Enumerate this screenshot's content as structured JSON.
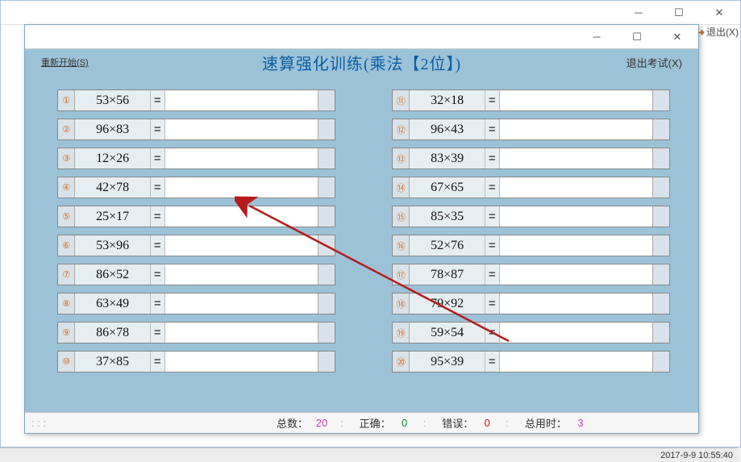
{
  "outer_window": {
    "exit_label": "退出(X)"
  },
  "inner_window": {
    "restart_label": "重新开始(S)",
    "title": "速算强化训练(乘法【2位】)",
    "exit_exam_label": "退出考试(X)"
  },
  "problems_left": [
    {
      "n": "①",
      "expr": "53×56"
    },
    {
      "n": "②",
      "expr": "96×83"
    },
    {
      "n": "③",
      "expr": "12×26"
    },
    {
      "n": "④",
      "expr": "42×78"
    },
    {
      "n": "⑤",
      "expr": "25×17"
    },
    {
      "n": "⑥",
      "expr": "53×96"
    },
    {
      "n": "⑦",
      "expr": "86×52"
    },
    {
      "n": "⑧",
      "expr": "63×49"
    },
    {
      "n": "⑨",
      "expr": "86×78"
    },
    {
      "n": "⑩",
      "expr": "37×85"
    }
  ],
  "problems_right": [
    {
      "n": "⑪",
      "expr": "32×18"
    },
    {
      "n": "⑫",
      "expr": "96×43"
    },
    {
      "n": "⑬",
      "expr": "83×39"
    },
    {
      "n": "⑭",
      "expr": "67×65"
    },
    {
      "n": "⑮",
      "expr": "85×35"
    },
    {
      "n": "⑯",
      "expr": "52×76"
    },
    {
      "n": "⑰",
      "expr": "78×87"
    },
    {
      "n": "⑱",
      "expr": "79×92"
    },
    {
      "n": "⑲",
      "expr": "59×54"
    },
    {
      "n": "⑳",
      "expr": "95×39"
    }
  ],
  "eq": "=",
  "status": {
    "total_label": "总数：",
    "total_value": "20",
    "correct_label": "正确：",
    "correct_value": "0",
    "wrong_label": "错误：",
    "wrong_value": "0",
    "time_label": "总用时：",
    "time_value": "3"
  },
  "timestamp": "2017-9-9 10:55:40"
}
